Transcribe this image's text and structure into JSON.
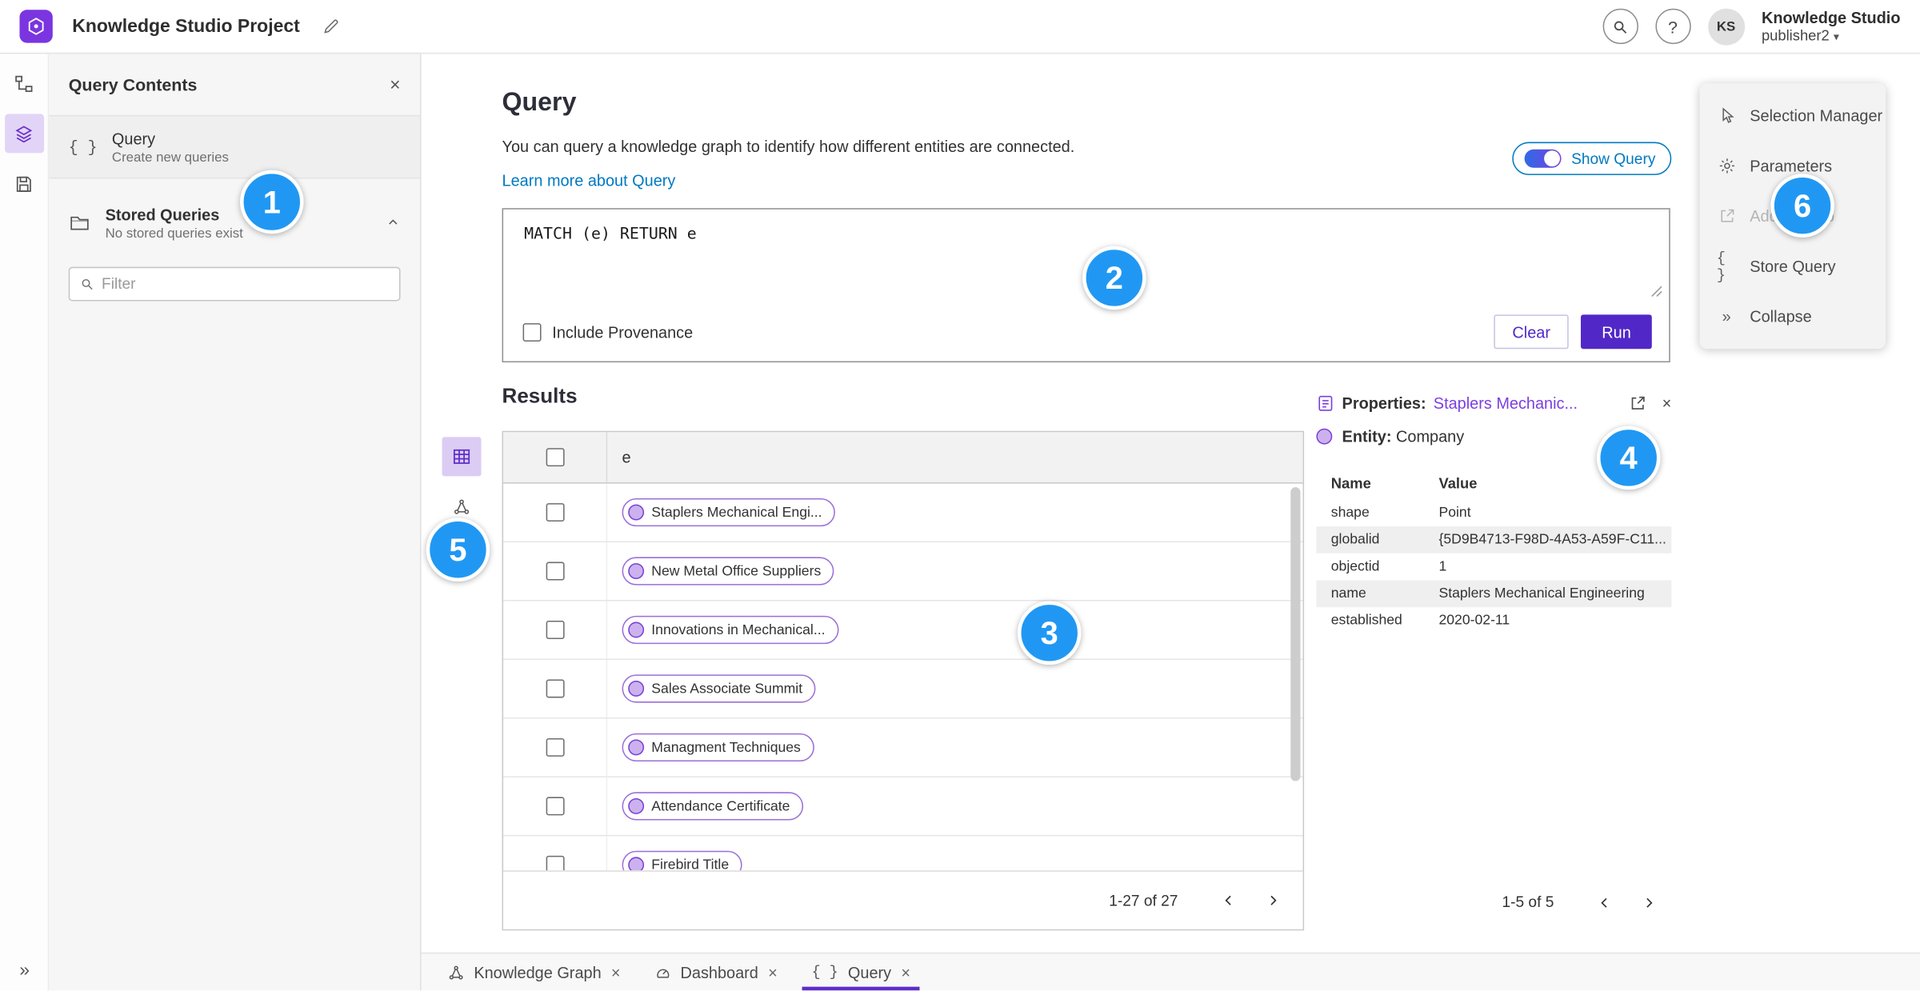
{
  "topbar": {
    "app_title": "Knowledge Studio Project",
    "user_org": "Knowledge Studio",
    "user_name": "publisher2",
    "avatar_initials": "KS"
  },
  "query_contents": {
    "title": "Query Contents",
    "query_label": "Query",
    "query_sublabel": "Create new queries",
    "stored_label": "Stored Queries",
    "stored_sublabel": "No stored queries exist",
    "filter_placeholder": "Filter"
  },
  "query_panel": {
    "heading": "Query",
    "description": "You can query a knowledge graph to identify how different entities are connected.",
    "learn_more": "Learn more about Query",
    "show_query": "Show Query",
    "code": "MATCH (e) RETURN e",
    "include_provenance": "Include Provenance",
    "clear": "Clear",
    "run": "Run"
  },
  "results": {
    "heading": "Results",
    "column_e": "e",
    "rows": [
      "Staplers Mechanical Engi...",
      "New Metal Office Suppliers",
      "Innovations in Mechanical...",
      "Sales Associate Summit",
      "Managment Techniques",
      "Attendance Certificate",
      "Firebird Title"
    ],
    "pagination": "1-27 of 27"
  },
  "properties": {
    "label": "Properties:",
    "entity_link": "Staplers Mechanic...",
    "entity_label": "Entity:",
    "entity_type": "Company",
    "col_name": "Name",
    "col_value": "Value",
    "rows": [
      {
        "name": "shape",
        "value": "Point"
      },
      {
        "name": "globalid",
        "value": "{5D9B4713-F98D-4A53-A59F-C11..."
      },
      {
        "name": "objectid",
        "value": "1"
      },
      {
        "name": "name",
        "value": "Staplers Mechanical Engineering"
      },
      {
        "name": "established",
        "value": "2020-02-11"
      }
    ],
    "pagination": "1-5 of 5"
  },
  "tools": {
    "selection_manager": "Selection Manager",
    "parameters": "Parameters",
    "add_to_map": "Add To Map",
    "store_query": "Store Query",
    "collapse": "Collapse"
  },
  "tabs": [
    {
      "label": "Knowledge Graph"
    },
    {
      "label": "Dashboard"
    },
    {
      "label": "Query"
    }
  ],
  "annotations": {
    "b1": "1",
    "b2": "2",
    "b3": "3",
    "b4": "4",
    "b5": "5",
    "b6": "6"
  },
  "icons": {
    "close": "×",
    "collapse": "»",
    "braces": "{ }",
    "help": "?",
    "caret_down": "▾"
  },
  "colors": {
    "accent_purple": "#5e2dc9",
    "link_blue": "#0079c1",
    "badge_blue": "#2098f3"
  }
}
